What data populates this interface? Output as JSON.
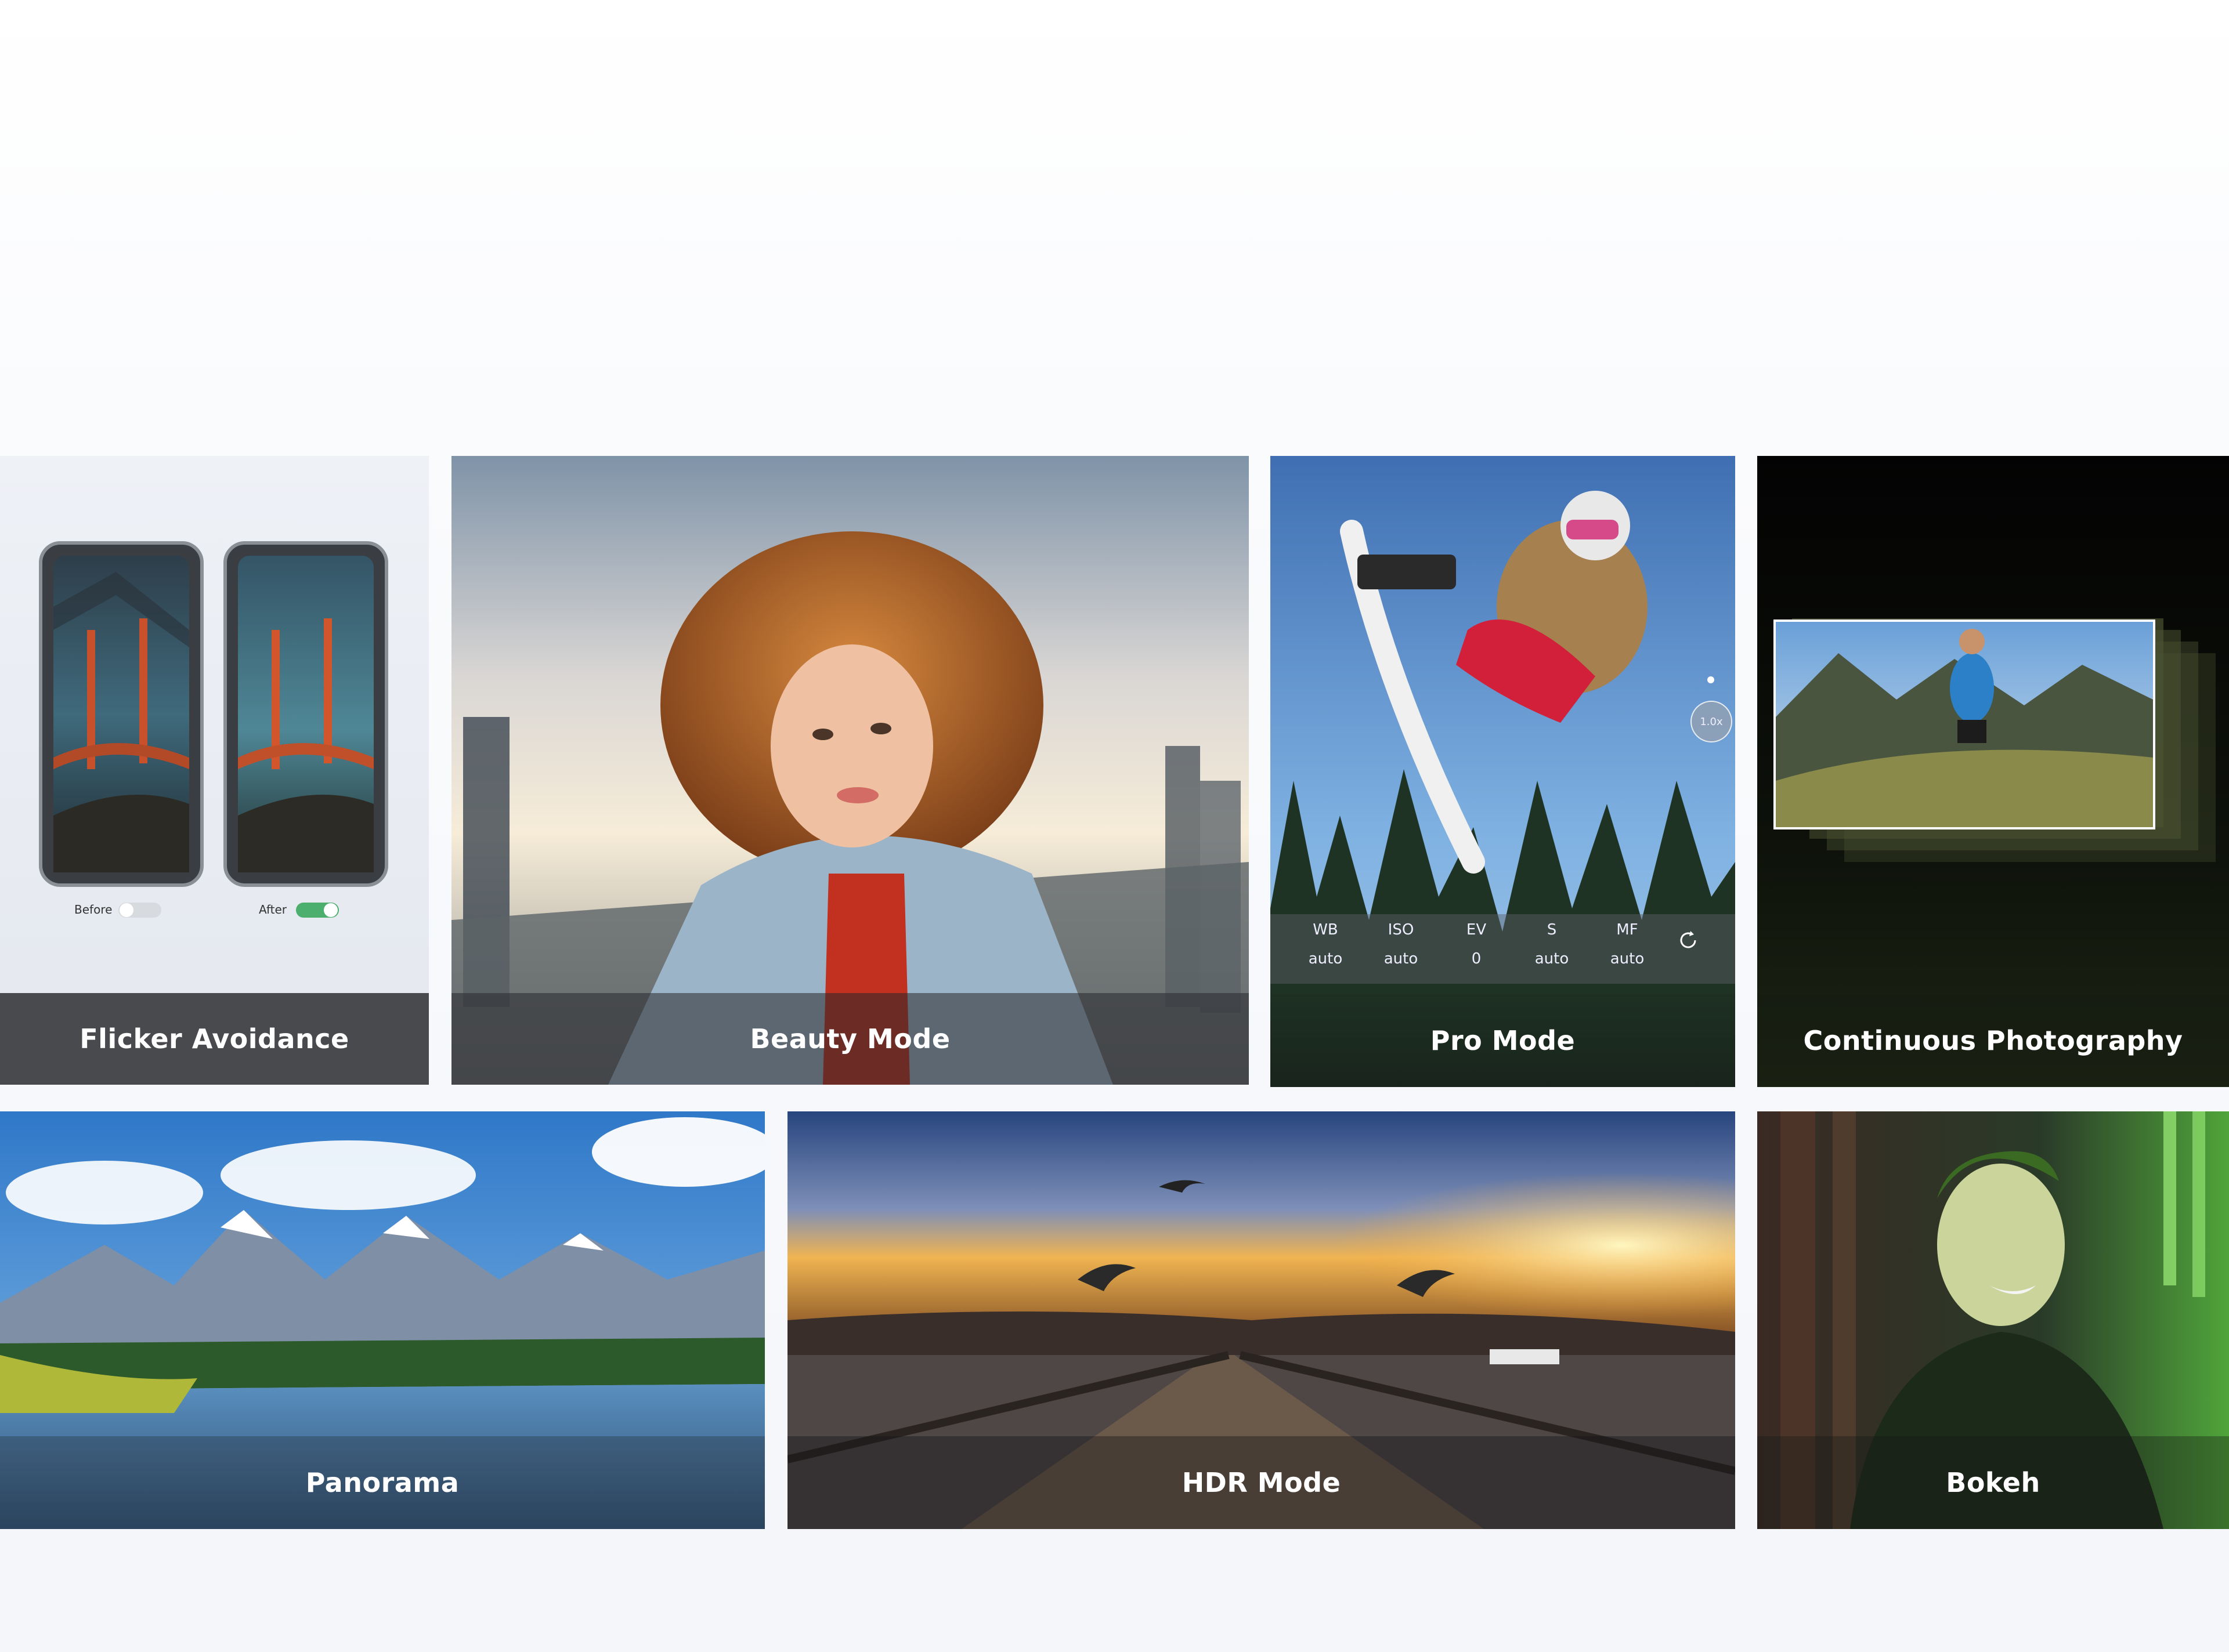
{
  "features": {
    "flicker": {
      "title": "Flicker Avoidance",
      "before_label": "Before",
      "after_label": "After",
      "before_toggle": "off",
      "after_toggle": "on"
    },
    "beauty": {
      "title": "Beauty Mode"
    },
    "pro": {
      "title": "Pro Mode",
      "zoom": "1.0x",
      "controls": [
        {
          "label": "WB",
          "value": "auto"
        },
        {
          "label": "ISO",
          "value": "auto"
        },
        {
          "label": "EV",
          "value": "0"
        },
        {
          "label": "S",
          "value": "auto"
        },
        {
          "label": "MF",
          "value": "auto"
        }
      ],
      "reset_icon": "refresh-icon"
    },
    "continuous": {
      "title": "Continuous Photography"
    },
    "panorama": {
      "title": "Panorama"
    },
    "hdr": {
      "title": "HDR Mode"
    },
    "bokeh": {
      "title": "Bokeh"
    }
  },
  "colors": {
    "toggle_on": "#4caf6e",
    "caption_bg": "rgba(40,40,44,0.78)"
  }
}
